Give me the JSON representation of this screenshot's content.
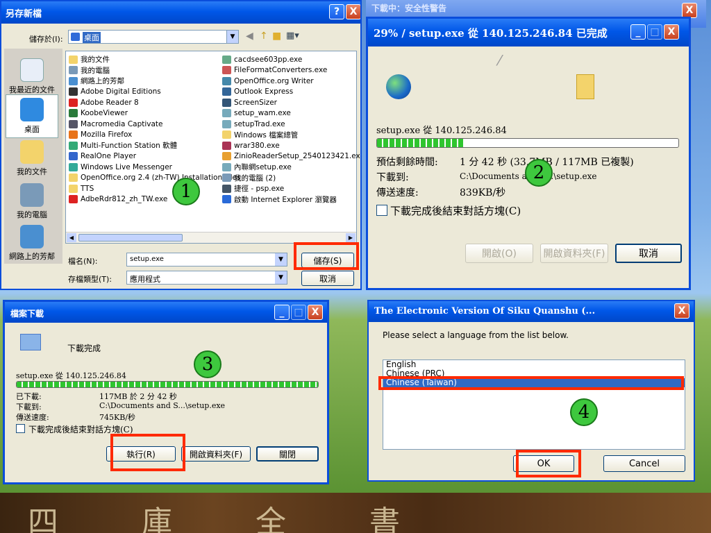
{
  "step_markers": [
    "1",
    "2",
    "3",
    "4"
  ],
  "panel1": {
    "title": "另存新檔",
    "help_btn": "?",
    "close_btn": "X",
    "save_in_label": "儲存於(I):",
    "save_in_value": "桌面",
    "places": [
      "我最近的文件",
      "桌面",
      "我的文件",
      "我的電腦",
      "網路上的芳鄰"
    ],
    "files_left": [
      "我的文件",
      "我的電腦",
      "網路上的芳鄰",
      "Adobe Digital Editions",
      "Adobe Reader 8",
      "KoobeViewer",
      "Macromedia Captivate",
      "Mozilla Firefox",
      "Multi-Function Station 軟體",
      "RealOne Player",
      "Windows Live Messenger",
      "OpenOffice.org 2.4 (zh-TW) Installation Files",
      "TTS",
      "AdbeRdr812_zh_TW.exe"
    ],
    "files_right": [
      "cacdsee603pp.exe",
      "FileFormatConverters.exe",
      "OpenOffice.org Writer",
      "Outlook Express",
      "ScreenSizer",
      "setup_wam.exe",
      "setupTrad.exe",
      "Windows 檔案總管",
      "wrar380.exe",
      "ZinioReaderSetup_2540123421.exe",
      "內聯網setup.exe",
      "我的電腦 (2)",
      "捷徑 - psp.exe",
      "啟動 Internet Explorer 瀏覽器"
    ],
    "filename_label": "檔名(N):",
    "filename_value": "setup.exe",
    "filetype_label": "存檔類型(T):",
    "filetype_value": "應用程式",
    "save_btn": "儲存(S)",
    "cancel_btn": "取消",
    "colors": {
      "highlight": "#ff2a00",
      "marker": "#3ec83e"
    }
  },
  "panel2": {
    "title_partial": "下載中：安全性警告",
    "title": "29% / setup.exe 從 140.125.246.84 已完成",
    "source": "setup.exe 從 140.125.246.84",
    "progress_percent": 29,
    "remaining_label": "預估剩餘時間:",
    "remaining_value": "1 分 42 秒 (33.7MB / 117MB 已複製)",
    "download_to_label": "下載到:",
    "download_to_value": "C:\\Documents and S...\\setup.exe",
    "rate_label": "傳送速度:",
    "rate_value": "839KB/秒",
    "close_on_complete": "下載完成後結束對話方塊(C)",
    "open_btn": "開啟(O)",
    "open_folder_btn": "開啟資料夾(F)",
    "cancel_btn": "取消"
  },
  "panel3": {
    "title": "檔案下載",
    "status": "下載完成",
    "source": "setup.exe 從 140.125.246.84",
    "progress_percent": 100,
    "downloaded_label": "已下載:",
    "downloaded_value": "117MB 於 2 分 42 秒",
    "download_to_label": "下載到:",
    "download_to_value": "C:\\Documents and S...\\setup.exe",
    "rate_label": "傳送速度:",
    "rate_value": "745KB/秒",
    "close_on_complete": "下載完成後結束對話方塊(C)",
    "run_btn": "執行(R)",
    "open_folder_btn": "開啟資料夾(F)",
    "close_btn": "關閉"
  },
  "panel4": {
    "title": "The Electronic Version Of Siku Quanshu (...",
    "prompt": "Please select a language from the list below.",
    "languages": [
      "English",
      "Chinese (PRC)",
      "Chinese (Taiwan)"
    ],
    "selected_language": "Chinese (Taiwan)",
    "ok_btn": "OK",
    "cancel_btn": "Cancel"
  },
  "bottom_banner": {
    "seal_text": "四庫全書"
  }
}
